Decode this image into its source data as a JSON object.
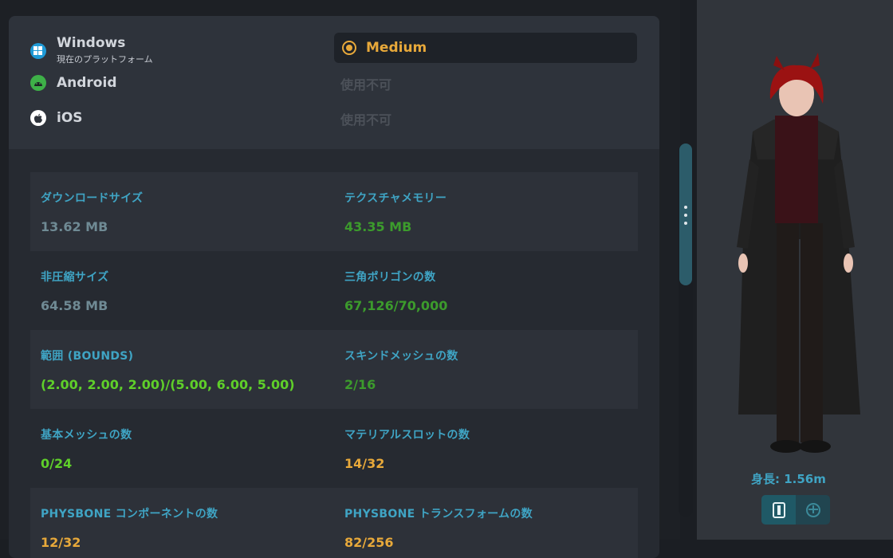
{
  "platforms": [
    {
      "name": "Windows",
      "subtitle": "現在のプラットフォーム",
      "icon": "windows-icon",
      "color": "#1f9ad6"
    },
    {
      "name": "Android",
      "icon": "android-icon",
      "color": "#3eb048"
    },
    {
      "name": "iOS",
      "icon": "apple-icon",
      "color": "#ffffff"
    }
  ],
  "quality": [
    {
      "label": "Medium",
      "selected": true
    },
    {
      "label": "使用不可",
      "selected": false
    },
    {
      "label": "使用不可",
      "selected": false
    }
  ],
  "stats": {
    "download_size": {
      "label": "ダウンロードサイズ",
      "value": "13.62 MB"
    },
    "texture_memory": {
      "label": "テクスチャメモリー",
      "value": "43.35 MB"
    },
    "uncompressed_size": {
      "label": "非圧縮サイズ",
      "value": "64.58 MB"
    },
    "triangles": {
      "label": "三角ポリゴンの数",
      "value": "67,126/70,000"
    },
    "bounds": {
      "label": "範囲 (BOUNDS)",
      "value": "(2.00, 2.00, 2.00)/(5.00, 6.00, 5.00)"
    },
    "skinned_meshes": {
      "label": "スキンドメッシュの数",
      "value": "2/16"
    },
    "basic_meshes": {
      "label": "基本メッシュの数",
      "value": "0/24"
    },
    "material_slots": {
      "label": "マテリアルスロットの数",
      "value": "14/32"
    },
    "physbone_components": {
      "label": "PHYSBONE コンポーネントの数",
      "value": "12/32"
    },
    "physbone_transforms": {
      "label": "PHYSBONE トランスフォームの数",
      "value": "82/256"
    }
  },
  "avatar": {
    "height_label": "身長: 1.56m"
  },
  "colors": {
    "accent": "#3fa4c4",
    "selected": "#e8a93a",
    "good": "#5fcf2a",
    "ok": "#3c9b2c"
  }
}
